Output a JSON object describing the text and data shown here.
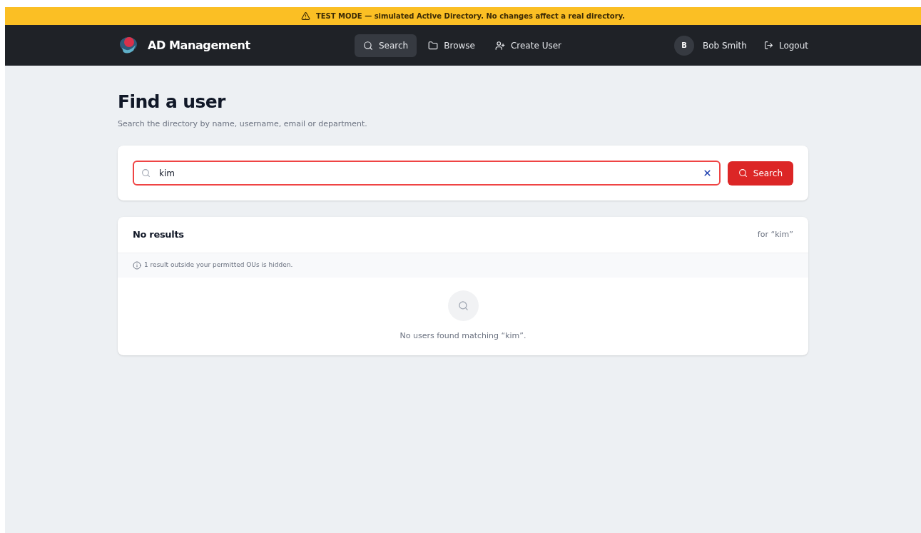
{
  "banner": {
    "text": "TEST MODE — simulated Active Directory. No changes affect a real directory."
  },
  "header": {
    "brand": "AD Management",
    "nav": [
      {
        "label": "Search",
        "selected": true
      },
      {
        "label": "Browse",
        "selected": false
      },
      {
        "label": "Create User",
        "selected": false
      }
    ],
    "user": {
      "initial": "B",
      "name": "Bob Smith"
    },
    "logout": "Logout"
  },
  "page": {
    "title": "Find a user",
    "subtitle": "Search the directory by name, username, email or department."
  },
  "search": {
    "value": "kim",
    "button": "Search"
  },
  "results": {
    "title": "No results",
    "query_note": "for “kim”",
    "notice": "1 result outside your permitted OUs is hidden.",
    "empty_message": "No users found matching “kim”."
  }
}
